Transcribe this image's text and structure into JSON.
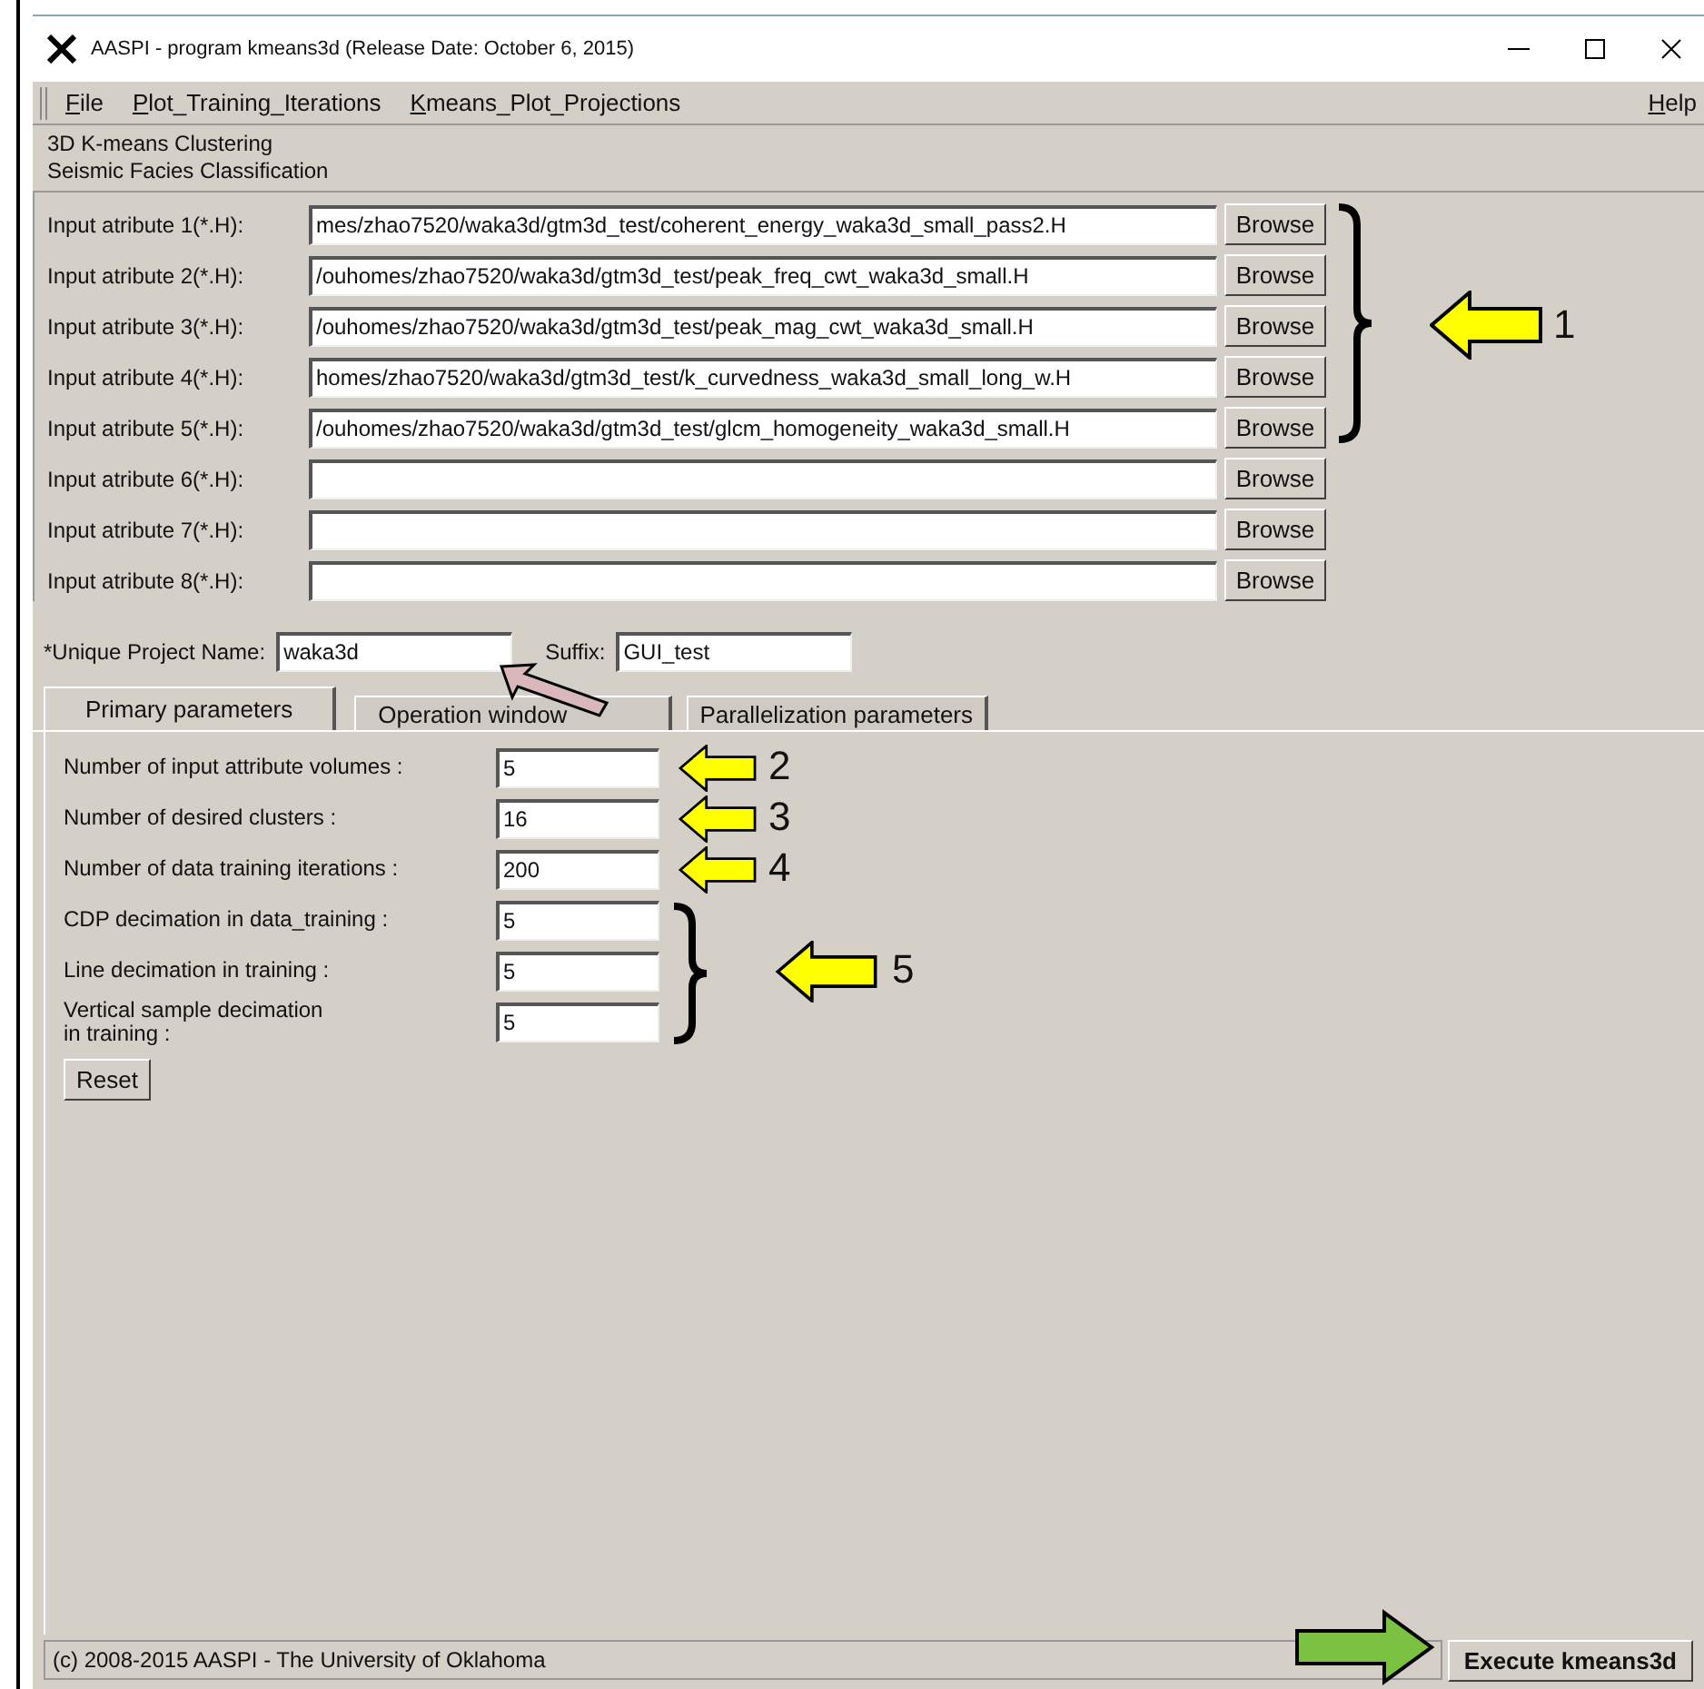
{
  "window": {
    "title": "AASPI - program kmeans3d (Release Date: October 6, 2015)"
  },
  "menu": {
    "items": [
      "File",
      "Plot_Training_Iterations",
      "Kmeans_Plot_Projections"
    ],
    "help": "Help"
  },
  "header": [
    "3D K-means Clustering",
    "Seismic Facies Classification"
  ],
  "inputs": [
    {
      "label": "Input atribute 1(*.H):",
      "value": "mes/zhao7520/waka3d/gtm3d_test/coherent_energy_waka3d_small_pass2.H",
      "button": "Browse"
    },
    {
      "label": "Input atribute 2(*.H):",
      "value": "/ouhomes/zhao7520/waka3d/gtm3d_test/peak_freq_cwt_waka3d_small.H",
      "button": "Browse"
    },
    {
      "label": "Input atribute 3(*.H):",
      "value": "/ouhomes/zhao7520/waka3d/gtm3d_test/peak_mag_cwt_waka3d_small.H",
      "button": "Browse"
    },
    {
      "label": "Input atribute 4(*.H):",
      "value": "homes/zhao7520/waka3d/gtm3d_test/k_curvedness_waka3d_small_long_w.H",
      "button": "Browse"
    },
    {
      "label": "Input atribute 5(*.H):",
      "value": "/ouhomes/zhao7520/waka3d/gtm3d_test/glcm_homogeneity_waka3d_small.H",
      "button": "Browse"
    },
    {
      "label": "Input atribute 6(*.H):",
      "button": "Browse"
    },
    {
      "label": "Input atribute 7(*.H):",
      "button": "Browse"
    },
    {
      "label": "Input atribute 8(*.H):",
      "button": "Browse"
    }
  ],
  "project": {
    "label": "*Unique Project Name:",
    "value": "waka3d",
    "suffix_label": "Suffix:",
    "suffix_value": "GUI_test"
  },
  "tabs": [
    {
      "label": "Primary parameters",
      "selected": true
    },
    {
      "label": "Operation window",
      "selected": false
    },
    {
      "label": "Parallelization parameters",
      "selected": false
    }
  ],
  "params": [
    {
      "label": "Number of input attribute volumes :",
      "value": "5"
    },
    {
      "label": "Number of desired clusters :",
      "value": "16"
    },
    {
      "label": "Number of data training iterations :",
      "value": "200"
    },
    {
      "label": "CDP decimation in data_training :",
      "value": "5"
    },
    {
      "label": "Line decimation in training :",
      "value": "5"
    },
    {
      "label": "Vertical sample decimation\nin training :",
      "value": "5"
    }
  ],
  "reset_button": "Reset",
  "annotations": [
    "1",
    "2",
    "3",
    "4",
    "5"
  ],
  "status_bar": {
    "text": "(c) 2008-2015 AASPI - The University of Oklahoma",
    "button": "Execute kmeans3d"
  }
}
